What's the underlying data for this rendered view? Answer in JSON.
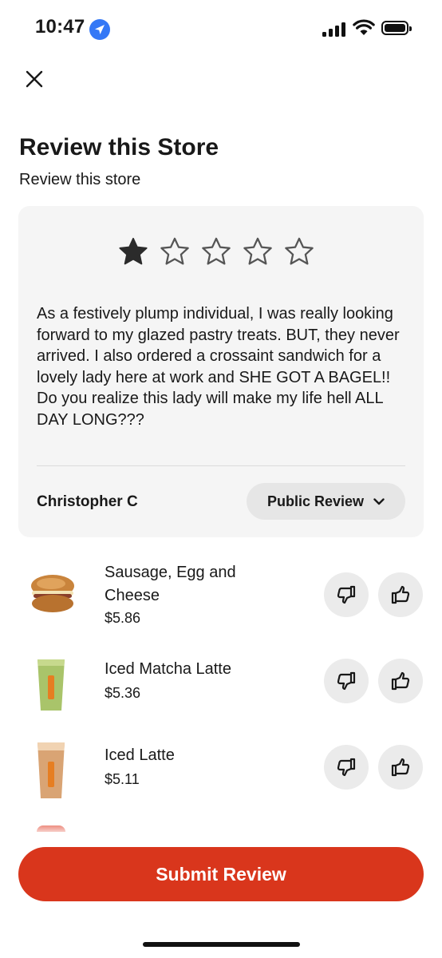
{
  "status_bar": {
    "time": "10:47"
  },
  "header": {
    "title": "Review this Store",
    "subtitle": "Review this store"
  },
  "review": {
    "rating": 1,
    "max_rating": 5,
    "text": "As a festively plump individual, I was really looking forward to my glazed pastry treats. BUT, they never arrived. I also ordered a crossaint sandwich for a lovely lady here at work and SHE GOT A BAGEL!! Do you realize this lady will make my life hell ALL DAY LONG???",
    "author": "Christopher C",
    "visibility": "Public Review"
  },
  "items": [
    {
      "name": "Sausage, Egg and Cheese",
      "price": "$5.86",
      "image": "croissant-sandwich"
    },
    {
      "name": "Iced Matcha Latte",
      "price": "$5.36",
      "image": "iced-matcha-cup"
    },
    {
      "name": "Iced Latte",
      "price": "$5.11",
      "image": "iced-latte-cup"
    }
  ],
  "submit_label": "Submit Review",
  "colors": {
    "accent": "#d9361c",
    "card_bg": "#f5f5f5",
    "chip_bg": "#e6e6e6",
    "location_blue": "#3478f6"
  }
}
